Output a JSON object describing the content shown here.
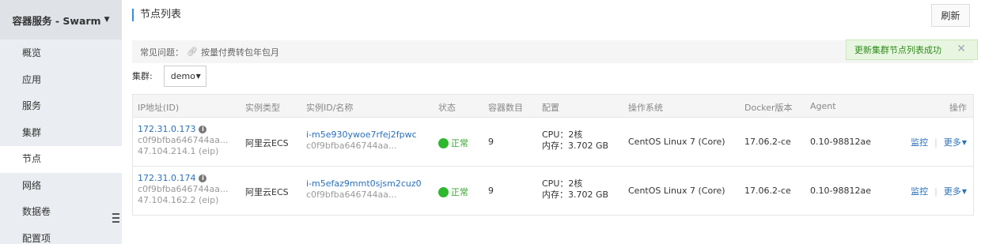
{
  "sidebar": {
    "header": "容器服务 - Swarm",
    "items": [
      {
        "label": "概览"
      },
      {
        "label": "应用"
      },
      {
        "label": "服务"
      },
      {
        "label": "集群"
      },
      {
        "label": "节点"
      },
      {
        "label": "网络"
      },
      {
        "label": "数据卷"
      },
      {
        "label": "配置项"
      }
    ],
    "active_index": 4
  },
  "page": {
    "title": "节点列表",
    "refresh_label": "刷新"
  },
  "faq": {
    "label": "常见问题：",
    "link": "按量付费转包年包月"
  },
  "toast": {
    "message": "更新集群节点列表成功",
    "close": "✕"
  },
  "cluster": {
    "label": "集群:",
    "selected": "demo"
  },
  "table": {
    "headers": [
      "IP地址(ID)",
      "实例类型",
      "实例ID/名称",
      "状态",
      "容器数目",
      "配置",
      "操作系统",
      "Docker版本",
      "Agent",
      "操作"
    ],
    "rows": [
      {
        "ip": "172.31.0.173",
        "id": "c0f9bfba646744aa...",
        "eip": "47.104.214.1  (eip)",
        "type": "阿里云ECS",
        "instance_id": "i-m5e930ywoe7rfej2fpwc",
        "instance_name": "c0f9bfba646744aa...",
        "status": "正常",
        "containers": "9",
        "cpu": "CPU：2核",
        "mem": "内存：3.702 GB",
        "os": "CentOS Linux 7 (Core)",
        "docker": "17.06.2-ce",
        "agent": "0.10-98812ae",
        "monitor": "监控",
        "more": "更多"
      },
      {
        "ip": "172.31.0.174",
        "id": "c0f9bfba646744aa...",
        "eip": "47.104.162.2  (eip)",
        "type": "阿里云ECS",
        "instance_id": "i-m5efaz9mmt0sjsm2cuz0",
        "instance_name": "c0f9bfba646744aa...",
        "status": "正常",
        "containers": "9",
        "cpu": "CPU：2核",
        "mem": "内存：3.702 GB",
        "os": "CentOS Linux 7 (Core)",
        "docker": "17.06.2-ce",
        "agent": "0.10-98812ae",
        "monitor": "监控",
        "more": "更多"
      }
    ]
  },
  "colors": {
    "link": "#2a6fb8",
    "status_ok": "#2eb82e",
    "toast_bg": "#e8f6e1",
    "accent": "#3b8cd8"
  }
}
